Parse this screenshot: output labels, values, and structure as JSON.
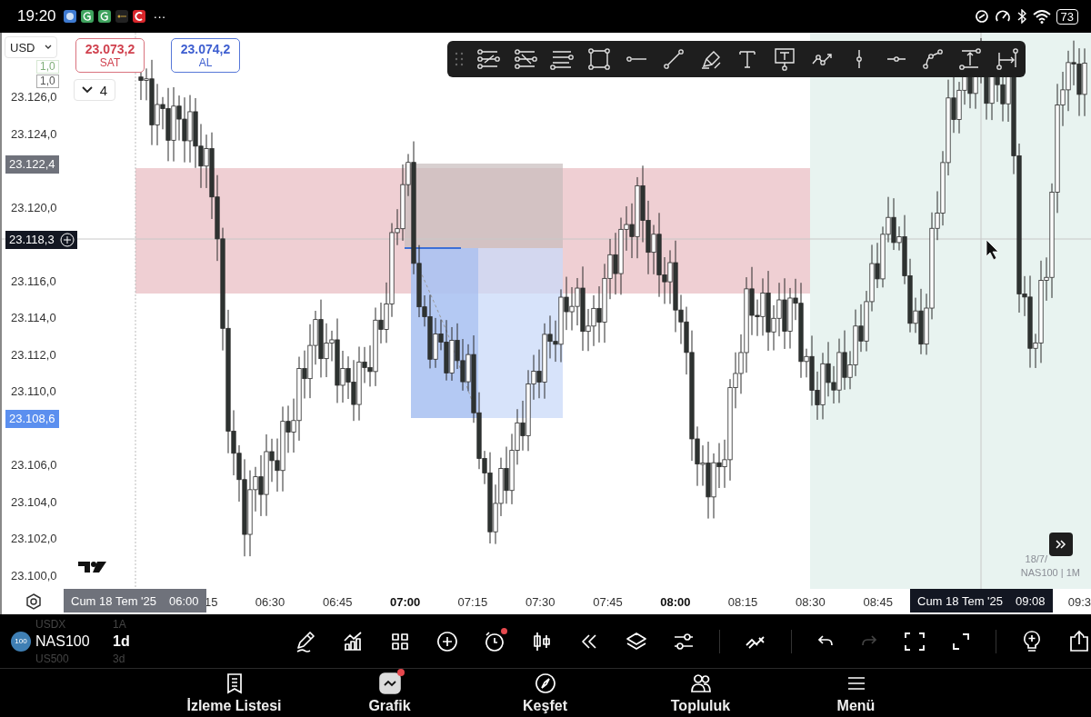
{
  "status_bar": {
    "time": "19:20",
    "more": "···",
    "battery": "73"
  },
  "trade_panel": {
    "currency": "USD",
    "sell": {
      "price": "23.073,2",
      "label": "SAT"
    },
    "buy": {
      "price": "23.074,2",
      "label": "AL"
    },
    "quantity_preview": "1,0",
    "quantity": "1,0",
    "positions": "4"
  },
  "price_axis": [
    {
      "kind": "label",
      "text": "23.126,0"
    },
    {
      "kind": "label",
      "text": "23.124,0"
    },
    {
      "kind": "grey",
      "text": "23.122,4"
    },
    {
      "kind": "label",
      "text": "23.120,0"
    },
    {
      "kind": "crosshair",
      "text": "23.118,3"
    },
    {
      "kind": "label",
      "text": "23.116,0"
    },
    {
      "kind": "label",
      "text": "23.114,0"
    },
    {
      "kind": "label",
      "text": "23.112,0"
    },
    {
      "kind": "label",
      "text": "23.110,0"
    },
    {
      "kind": "blue",
      "text": "23.108,6"
    },
    {
      "kind": "label",
      "text": "23.106,0"
    },
    {
      "kind": "label",
      "text": "23.104,0"
    },
    {
      "kind": "label",
      "text": "23.102,0"
    },
    {
      "kind": "label",
      "text": "23.100,0"
    }
  ],
  "time_axis": {
    "labels": [
      {
        "text": "15",
        "bold": false
      },
      {
        "text": "06:30",
        "bold": false
      },
      {
        "text": "06:45",
        "bold": false
      },
      {
        "text": "07:00",
        "bold": true
      },
      {
        "text": "07:15",
        "bold": false
      },
      {
        "text": "07:30",
        "bold": false
      },
      {
        "text": "07:45",
        "bold": false
      },
      {
        "text": "08:00",
        "bold": true
      },
      {
        "text": "08:15",
        "bold": false
      },
      {
        "text": "08:30",
        "bold": false
      },
      {
        "text": "08:45",
        "bold": false
      }
    ],
    "end_label": "09:3",
    "markers": [
      {
        "date": "Cum 18 Tem '25",
        "time": "06:00"
      },
      {
        "date": "Cum 18 Tem '25",
        "time": "09:08"
      }
    ]
  },
  "legend": {
    "date": "18/7/",
    "symbol": "NAS100 | 1M"
  },
  "symbols": [
    {
      "name": "USDX",
      "interval": "1A",
      "selected": false
    },
    {
      "name": "NAS100",
      "interval": "1d",
      "selected": true,
      "badge": "100"
    },
    {
      "name": "US500",
      "interval": "3d",
      "selected": false
    }
  ],
  "bottom_toolbar": {
    "alert": {
      "badge": true
    },
    "redo": {
      "disabled": true
    }
  },
  "nav": [
    {
      "kind": "list",
      "label": "İzleme Listesi",
      "selected": false,
      "badge": false
    },
    {
      "kind": "chart",
      "label": "Grafik",
      "selected": true,
      "badge": true
    },
    {
      "kind": "compass",
      "label": "Keşfet",
      "selected": false,
      "badge": false
    },
    {
      "kind": "people",
      "label": "Topluluk",
      "selected": false,
      "badge": false
    },
    {
      "kind": "menu",
      "label": "Menü",
      "selected": false,
      "badge": false
    }
  ]
}
